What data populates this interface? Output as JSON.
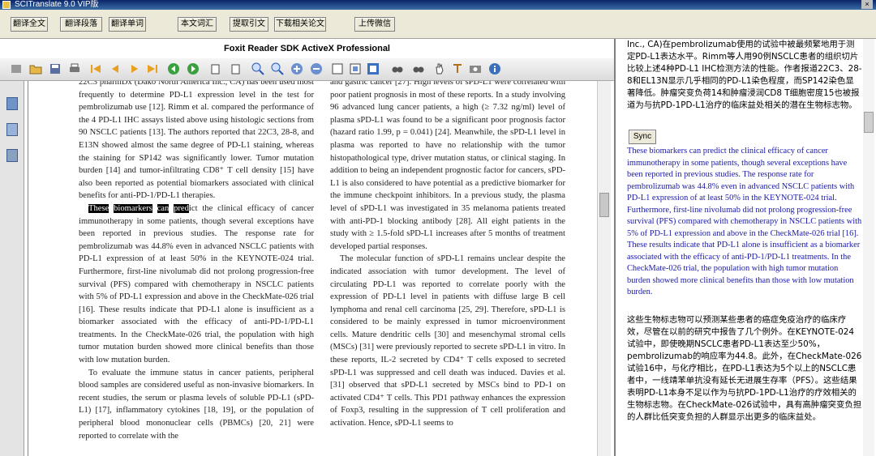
{
  "window": {
    "title": "SCITranslate 9.0 VIP版",
    "close_glyph": "×"
  },
  "toolbar": {
    "buttons": [
      "翻译全文",
      "翻译段落",
      "翻译单词",
      "本文词汇",
      "提取引文",
      "下载相关论文",
      "上传微信"
    ]
  },
  "viewer": {
    "title": "Foxit Reader SDK ActiveX Professional"
  },
  "document": {
    "left_col": [
      "22C3 pharmDx (Dako North America Inc., CA) has been used most frequently to determine PD-L1 expression level in the test for pembrolizumab use [12]. Rimm et al. compared the performance of the 4 PD-L1 IHC assays listed above using histologic sections from 90 NSCLC patients [13]. The authors reported that 22C3, 28-8, and E13N showed almost the same degree of PD-L1 staining, whereas the staining for SP142 was significantly lower. Tumor mutation burden [14] and tumor-infiltrating CD8⁺ T cell density [15] have also been reported as potential biomarkers associated with clinical benefits for anti-PD-1/PD-L1 therapies."
    ],
    "highlight_words": [
      "These",
      "biomarkers",
      "can",
      "pred"
    ],
    "left_col_p2_rest": "ict the clinical efficacy of cancer immunotherapy in some patients, though several exceptions have been reported in previous studies. The response rate for pembrolizumab was 44.8% even in advanced NSCLC patients with PD-L1 expression of at least 50% in the KEYNOTE-024 trial. Furthermore, first-line nivolumab did not prolong progression-free survival (PFS) compared with chemotherapy in NSCLC patients with 5% of PD-L1 expression and above in the CheckMate-026 trial [16]. These results indicate that PD-L1 alone is insufficient as a biomarker associated with the efficacy of anti-PD-1/PD-L1 treatments. In the CheckMate-026 trial, the population with high tumor mutation burden showed more clinical benefits than those with low mutation burden.",
    "left_col_p3": "To evaluate the immune status in cancer patients, peripheral blood samples are considered useful as non-invasive biomarkers. In recent studies, the serum or plasma levels of soluble PD-L1 (sPD-L1) [17], inflammatory cytokines [18, 19], or the population of peripheral blood mononuclear cells (PBMCs) [20, 21] were reported to correlate with the",
    "right_col_p1": "and gastric cancer [27]. High levels of sPD-L1 were correlated with poor patient prognosis in most of these reports. In a study involving 96 advanced lung cancer patients, a high (≥ 7.32 ng/ml) level of plasma sPD-L1 was found to be a significant poor prognosis factor (hazard ratio 1.99, p = 0.041) [24]. Meanwhile, the sPD-L1 level in plasma was reported to have no relationship with the tumor histopathological type, driver mutation status, or clinical staging. In addition to being an independent prognostic factor for cancers, sPD-L1 is also considered to have potential as a predictive biomarker for the immune checkpoint inhibitors. In a previous study, the plasma level of sPD-L1 was investigated in 35 melanoma patients treated with anti-PD-1 blocking antibody [28]. All eight patients in the study with ≥ 1.5-fold sPD-L1 increases after 5 months of treatment developed partial responses.",
    "right_col_p2": "The molecular function of sPD-L1 remains unclear despite the indicated association with tumor development. The level of circulating PD-L1 was reported to correlate poorly with the expression of PD-L1 level in patients with diffuse large B cell lymphoma and renal cell carcinoma [25, 29]. Therefore, sPD-L1 is considered to be mainly expressed in tumor microenvironment cells. Mature dendritic cells [30] and mesenchymal stromal cells (MSCs) [31] were previously reported to secrete sPD-L1 in vitro. In these reports, IL-2 secreted by CD4⁺ T cells exposed to secreted sPD-L1 was suppressed and cell death was induced. Davies et al. [31] observed that sPD-L1 secreted by MSCs bind to PD-1 on activated CD4⁺ T cells. This PD1 pathway enhances the expression of Foxp3, resulting in the suppression of T cell proliferation and activation. Hence, sPD-L1 seems to"
  },
  "translation": {
    "top_cn": "Inc., CA)在pembrolizumab使用的试验中被最频繁地用于测定PD-L1表达水平。Rimm等人用90例NSCLC患者的组织切片比较上述4种PD-L1 IHC检测方法的性能。作者报道22C3、28-8和EL13N显示几乎相同的PD-L1染色程度，而SP142染色显著降低。肿瘤突变负荷14和肿瘤浸润CD8 T细胞密度15也被报道为与抗PD-1PD-L1治疗的临床益处相关的潜在生物标志物。",
    "sync_label": "Sync",
    "source_en": "These biomarkers can predict the clinical efficacy of cancer immunotherapy in some patients, though several exceptions have been reported in previous studies. The response rate for pembrolizumab was 44.8% even in advanced NSCLC patients with PD-L1 expression of at least 50% in the KEYNOTE-024 trial. Furthermore, first-line nivolumab did not prolong progression-free survival (PFS) compared with chemotherapy in NSCLC patients with 5% of PD-L1 expression and above in the CheckMate-026 trial [16]. These results indicate that PD-L1 alone is insufficient as a biomarker associated with the efficacy of anti-PD-1/PD-L1 treatments. In the CheckMate-026 trial, the population with high tumor mutation burden showed more clinical benefits than those with low mutation burden.",
    "target_cn": "这些生物标志物可以预测某些患者的癌症免疫治疗的临床疗效，尽管在以前的研究中报告了几个例外。在KEYNOTE-024试验中，即使晚期NSCLC患者PD-L1表达至少50%，pembrolizumab的响应率为44.8。此外，在CheckMate-026试验16中，与化疗相比，在PD-L1表达为5个以上的NSCLC患者中，一线靖苯单抗没有延长无进展生存率（PFS）。这些结果表明PD-L1本身不足以作为与抗PD-1PD-L1治疗的疗效相关的生物标志物。在CheckMate-026试验中，具有高肿瘤突变负担的人群比低突变负担的人群显示出更多的临床益处。"
  }
}
